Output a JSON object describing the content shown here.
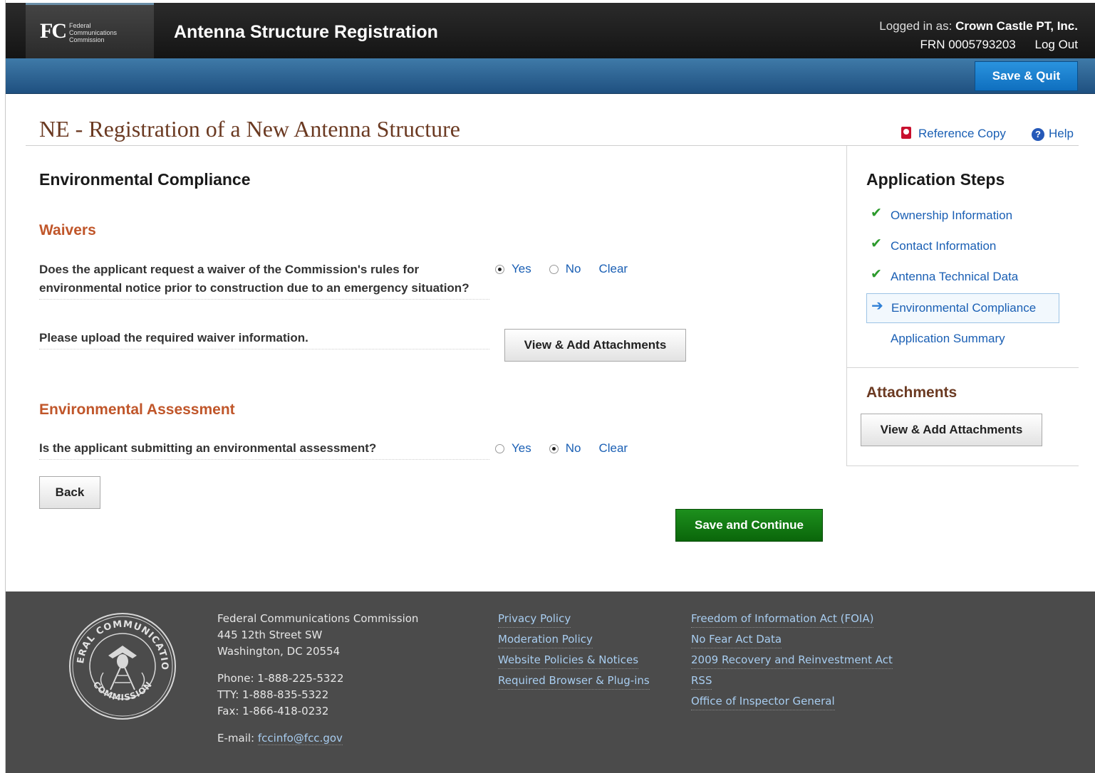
{
  "header": {
    "logo_mark": "FC",
    "logo_lines": [
      "Federal",
      "Communications",
      "Commission"
    ],
    "app_title": "Antenna Structure Registration",
    "logged_in_label": "Logged in as:",
    "user_name": "Crown Castle PT, Inc.",
    "frn": "FRN 0005793203",
    "logout_label": "Log Out",
    "save_quit_label": "Save & Quit"
  },
  "page": {
    "title": "NE - Registration of a New Antenna Structure",
    "reference_copy_label": "Reference Copy",
    "help_label": "Help"
  },
  "main": {
    "section_title": "Environmental Compliance",
    "waivers": {
      "heading": "Waivers",
      "question": "Does the applicant request a waiver of the Commission's rules for environmental notice prior to construction due to an emergency situation?",
      "options": [
        "Yes",
        "No"
      ],
      "selected": "Yes",
      "clear_label": "Clear",
      "upload_prompt": "Please upload the required waiver information.",
      "attach_button_label": "View & Add Attachments"
    },
    "assessment": {
      "heading": "Environmental Assessment",
      "question": "Is the applicant submitting an environmental assessment?",
      "options": [
        "Yes",
        "No"
      ],
      "selected": "No",
      "clear_label": "Clear"
    },
    "back_label": "Back",
    "save_continue_label": "Save and Continue"
  },
  "sidebar": {
    "title": "Application Steps",
    "steps": [
      {
        "label": "Ownership Information",
        "status": "complete"
      },
      {
        "label": "Contact Information",
        "status": "complete"
      },
      {
        "label": "Antenna Technical Data",
        "status": "complete"
      },
      {
        "label": "Environmental Compliance",
        "status": "current"
      },
      {
        "label": "Application Summary",
        "status": "pending"
      }
    ],
    "attachments_title": "Attachments",
    "attach_button_label": "View & Add Attachments"
  },
  "footer": {
    "org": "Federal Communications Commission",
    "street": "445 12th Street SW",
    "city": "Washington, DC 20554",
    "phone": "Phone: 1-888-225-5322",
    "tty": "TTY: 1-888-835-5322",
    "fax": "Fax: 1-866-418-0232",
    "email_label": "E-mail:",
    "email": "fccinfo@fcc.gov",
    "seal_text_top": "FEDERAL COMMUNICATIONS",
    "seal_text_bottom": "COMMISSION",
    "links_col2": [
      "Privacy Policy",
      "Moderation Policy",
      "Website Policies & Notices",
      "Required Browser & Plug-ins"
    ],
    "links_col3": [
      "Freedom of Information Act (FOIA)",
      "No Fear Act Data",
      "2009 Recovery and Reinvestment Act",
      "RSS",
      "Office of Inspector General"
    ]
  },
  "colors": {
    "header_bg": "#1f1f1f",
    "blue_bar": "#2c6595",
    "link": "#1a5fb4",
    "title_brown": "#6b3a22",
    "subhead_orange": "#c0562a",
    "primary_green": "#11761a",
    "footer_bg": "#4b4b4b"
  },
  "icons": {
    "reference_copy": "pdf-icon",
    "help": "help-icon",
    "step_complete": "check-icon",
    "step_current": "arrow-right-icon",
    "footer_seal": "fcc-seal-icon"
  }
}
